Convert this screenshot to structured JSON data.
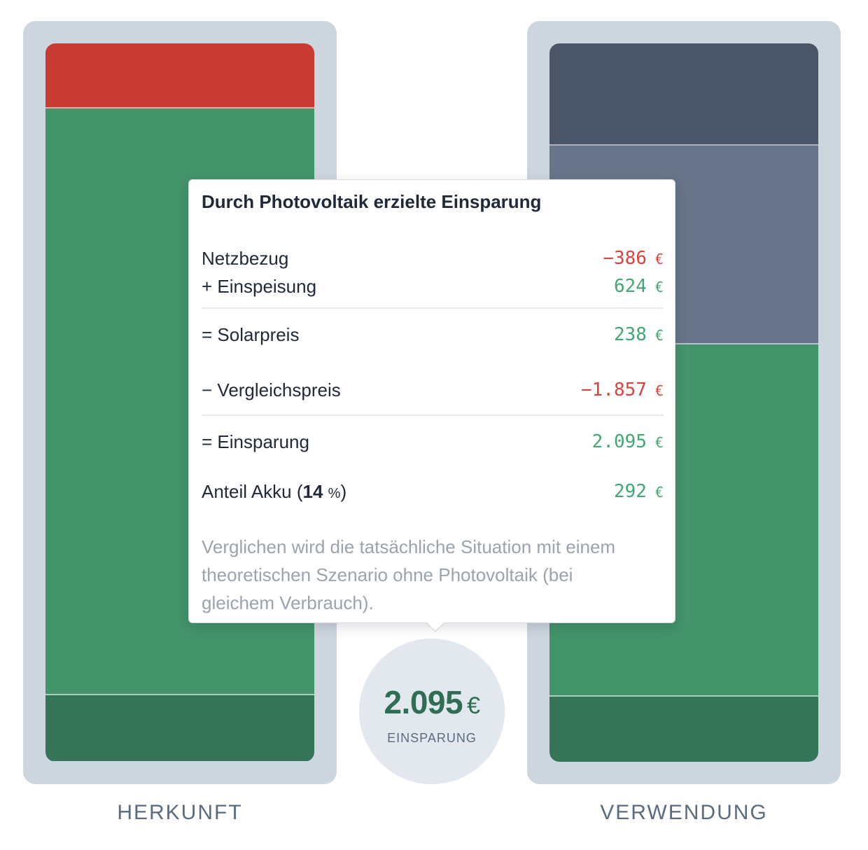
{
  "colors": {
    "grid_import": "#c93a32",
    "pv_direct": "#43936b",
    "battery": "#347559",
    "export_dark": "#4a5568",
    "export_mid": "#677489",
    "frame": "#cdd5df",
    "negative": "#d9433b",
    "positive": "#3fa874"
  },
  "herkunft": {
    "label": "HERKUNFT",
    "segments": [
      {
        "name": "netzbezug",
        "fraction": 0.091,
        "color": "#c93a32"
      },
      {
        "name": "pv-direkt",
        "fraction": 0.817,
        "color": "#43936b"
      },
      {
        "name": "akku",
        "fraction": 0.092,
        "color": "#347559"
      }
    ]
  },
  "verwendung": {
    "label": "VERWENDUNG",
    "segments": [
      {
        "name": "einspeisung",
        "fraction": 0.142,
        "color": "#4a5568"
      },
      {
        "name": "verbrauch-netz",
        "fraction": 0.277,
        "color": "#677489"
      },
      {
        "name": "verbrauch-pv",
        "fraction": 0.49,
        "color": "#43936b"
      },
      {
        "name": "akku",
        "fraction": 0.091,
        "color": "#347559"
      }
    ]
  },
  "savings": {
    "value": "2.095",
    "currency": "€",
    "caption": "EINSPARUNG"
  },
  "tooltip": {
    "title": "Durch Photovoltaik erzielte Einsparung",
    "rows": [
      {
        "label": "Netzbezug",
        "value": "−386",
        "currency": "€"
      },
      {
        "label": "+ Einspeisung",
        "value": "624",
        "currency": "€"
      },
      {
        "label": "= Solarpreis",
        "value": "238",
        "currency": "€"
      },
      {
        "label": "− Vergleichspreis",
        "value": "−1.857",
        "currency": "€"
      },
      {
        "label": "= Einsparung",
        "value": "2.095",
        "currency": "€"
      },
      {
        "label_prefix": "Anteil Akku (",
        "percent_value": "14",
        "percent_unit": "%",
        "label_suffix": ")",
        "value": "292",
        "currency": "€"
      }
    ],
    "note": "Verglichen wird die tatsächliche Situation mit einem theoretischen Szenario ohne Photovoltaik (bei gleichem Verbrauch)."
  }
}
